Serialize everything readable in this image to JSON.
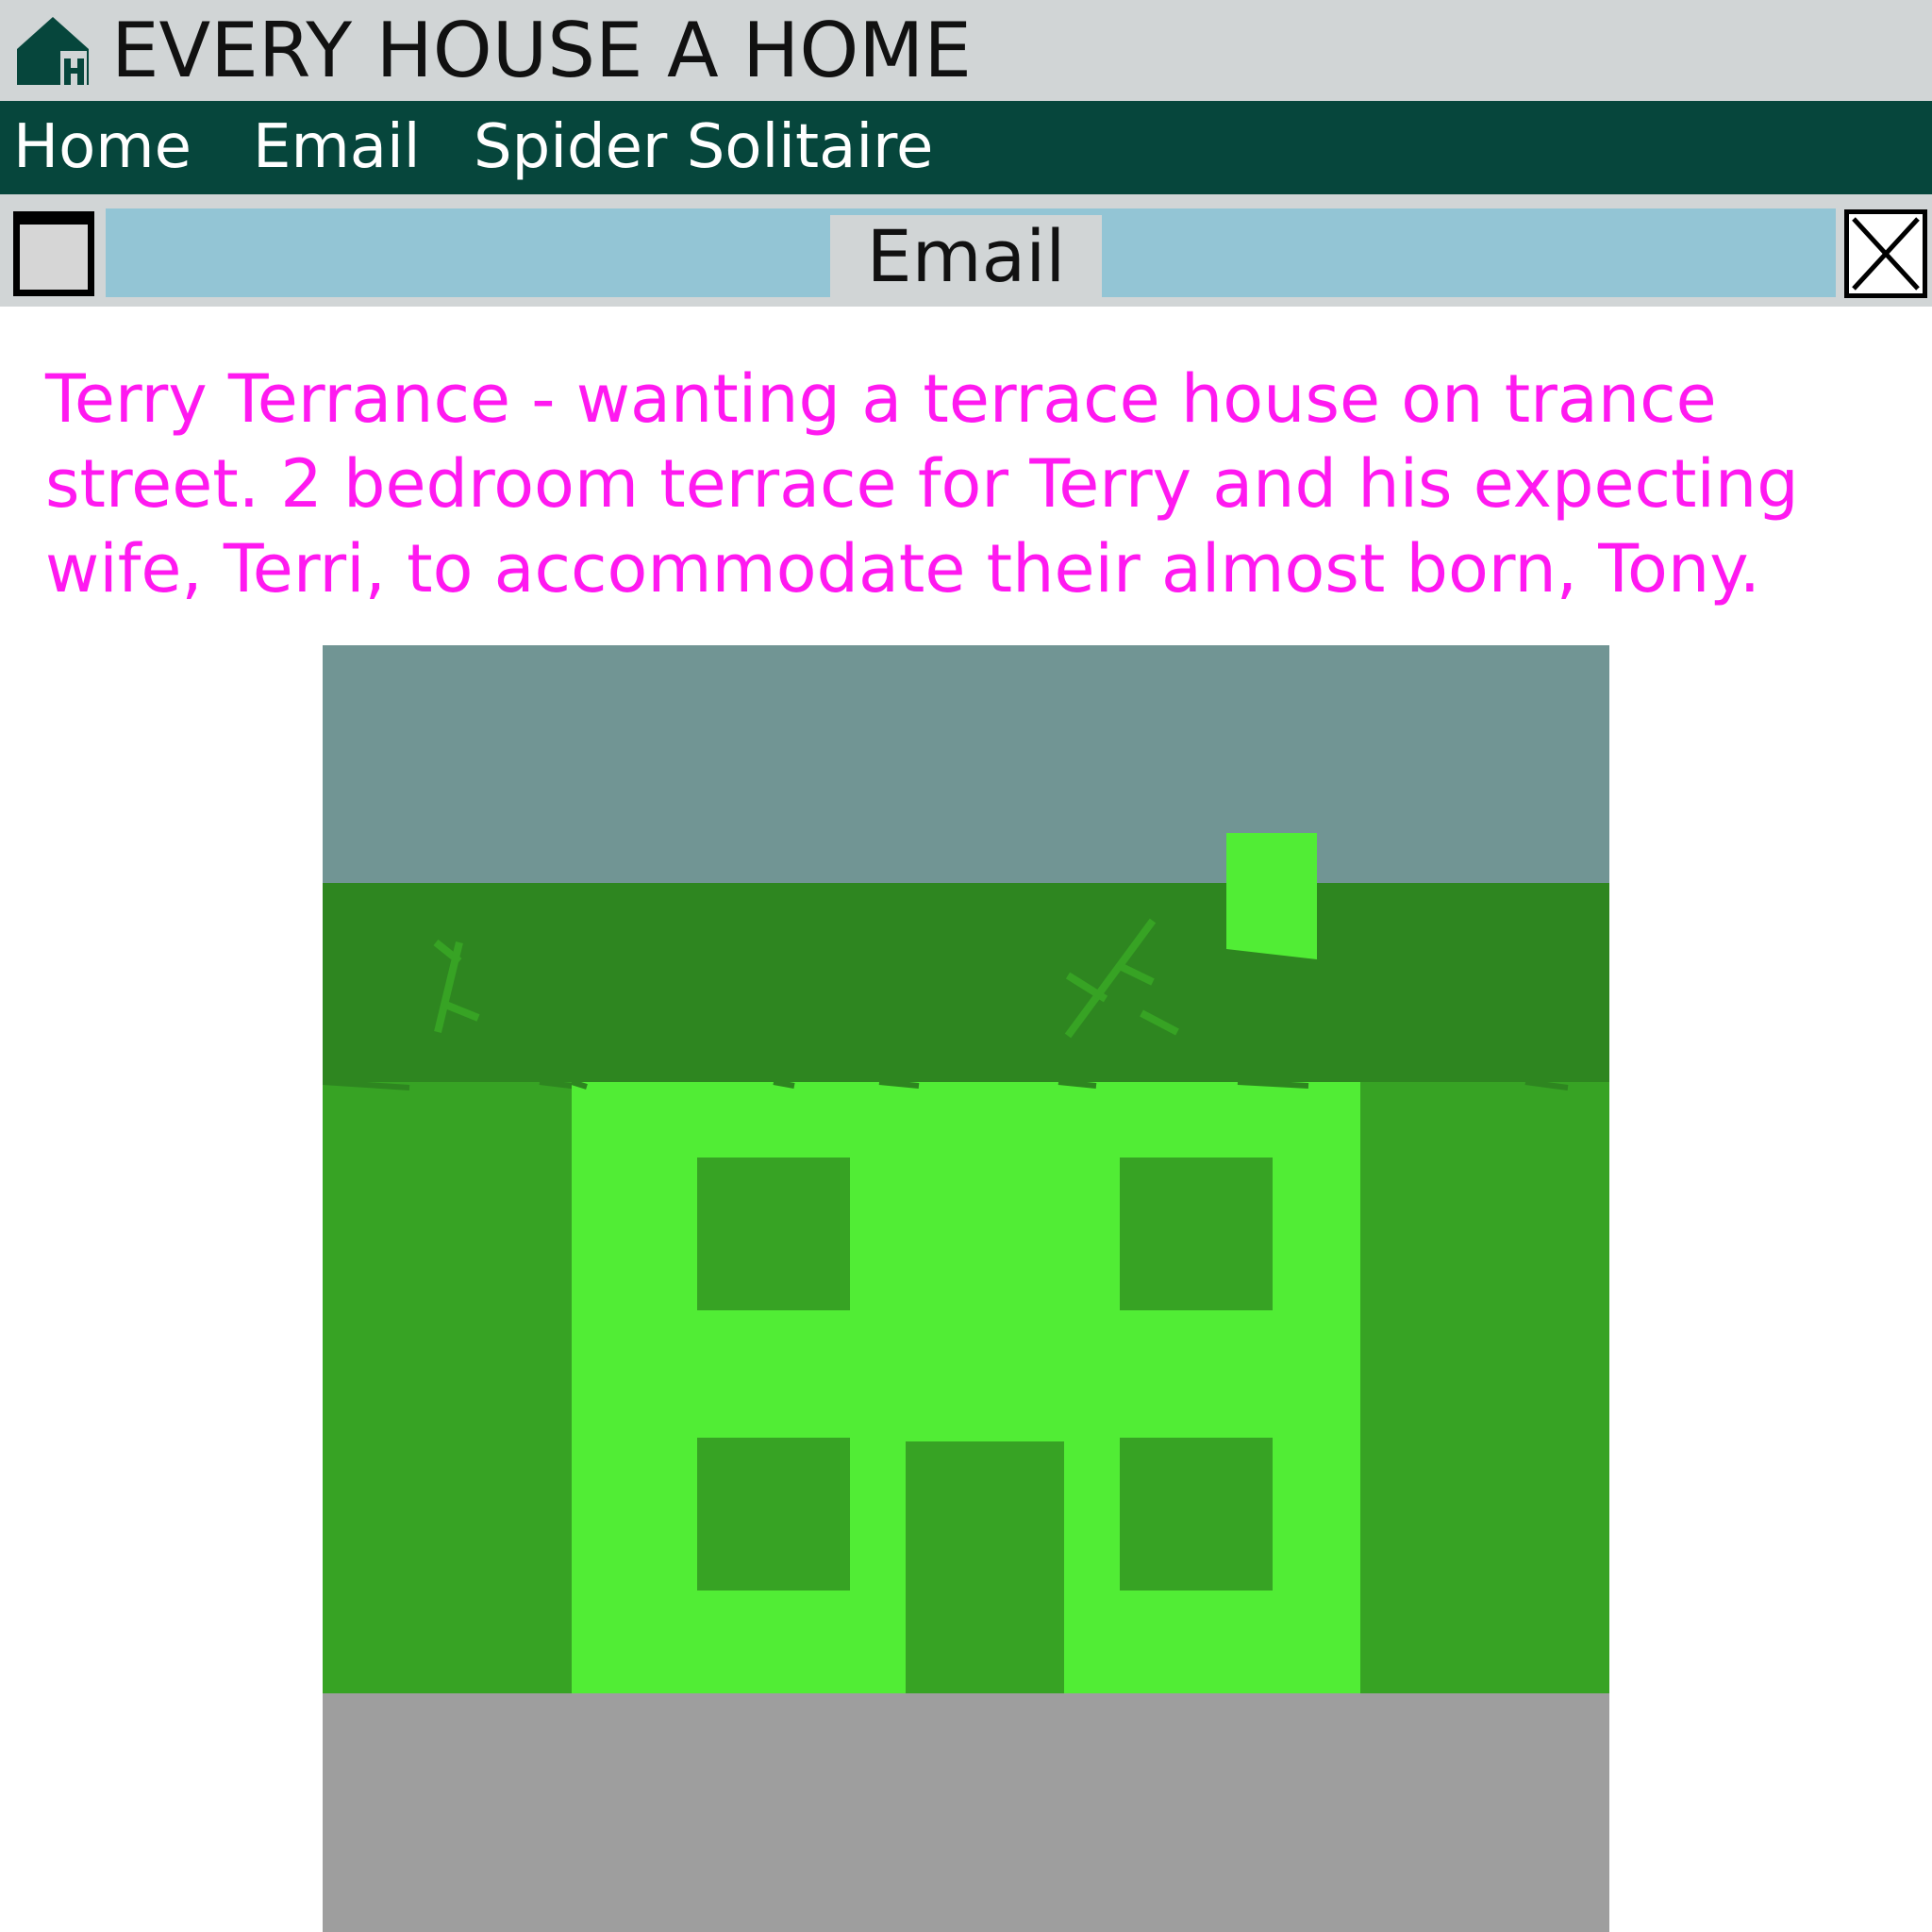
{
  "app": {
    "title": "EVERY HOUSE A HOME",
    "logo_icon": "house-logo-icon"
  },
  "nav": {
    "items": [
      {
        "label": "Home"
      },
      {
        "label": "Email"
      },
      {
        "label": "Spider Solitaire"
      }
    ]
  },
  "window": {
    "title": "Email",
    "toggle_icon": "window-icon",
    "close_icon": "close-icon"
  },
  "email": {
    "body": "Terry Terrance - wanting a terrace house on trance street. 2 bedroom terrace for Terry and his expecting wife, Terri, to accommodate their almost born, Tony."
  },
  "colors": {
    "title_bar": "#d1d5d6",
    "nav_bar": "#06463c",
    "window_strip": "#93c5d5",
    "email_text": "#ff19f0",
    "sky": "#719594",
    "roof": "#2e8620",
    "neighbor_wall": "#37a324",
    "house_wall": "#51ed35",
    "road": "#9e9e9e"
  }
}
